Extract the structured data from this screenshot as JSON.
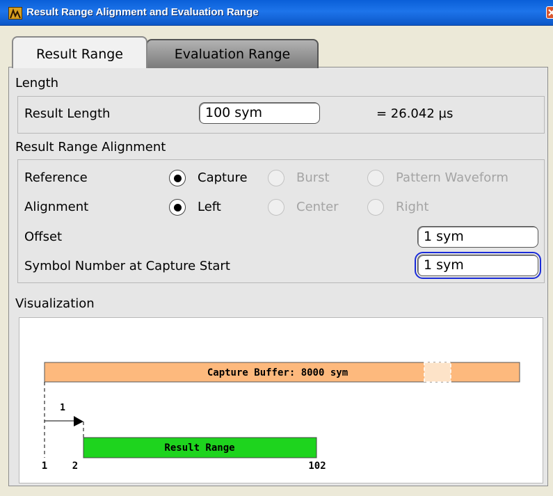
{
  "window": {
    "title": "Result Range Alignment and Evaluation Range"
  },
  "tabs": [
    {
      "label": "Result Range",
      "active": true
    },
    {
      "label": "Evaluation Range",
      "active": false
    }
  ],
  "length": {
    "heading": "Length",
    "result_length_label": "Result Length",
    "result_length_value": "100 sym",
    "result_length_time": "= 26.042 µs"
  },
  "alignment": {
    "heading": "Result Range Alignment",
    "reference_label": "Reference",
    "reference_options": [
      {
        "label": "Capture",
        "selected": true,
        "enabled": true
      },
      {
        "label": "Burst",
        "selected": false,
        "enabled": false
      },
      {
        "label": "Pattern Waveform",
        "selected": false,
        "enabled": false
      }
    ],
    "alignment_label": "Alignment",
    "alignment_options": [
      {
        "label": "Left",
        "selected": true,
        "enabled": true
      },
      {
        "label": "Center",
        "selected": false,
        "enabled": false
      },
      {
        "label": "Right",
        "selected": false,
        "enabled": false
      }
    ],
    "offset_label": "Offset",
    "offset_value": "1 sym",
    "symbol_number_label": "Symbol Number at Capture Start",
    "symbol_number_value": "1 sym"
  },
  "visualization": {
    "heading": "Visualization",
    "capture_buffer_label": "Capture Buffer: 8000 sym",
    "result_range_label": "Result Range",
    "offset_marker": "1",
    "start_tick": "1",
    "result_start_tick": "2",
    "result_end_tick": "102"
  },
  "colors": {
    "capture_buffer": "#fdb97d",
    "result_range": "#1ed41e",
    "titlebar": "#1d74ea",
    "focus": "#1a2bd8"
  }
}
